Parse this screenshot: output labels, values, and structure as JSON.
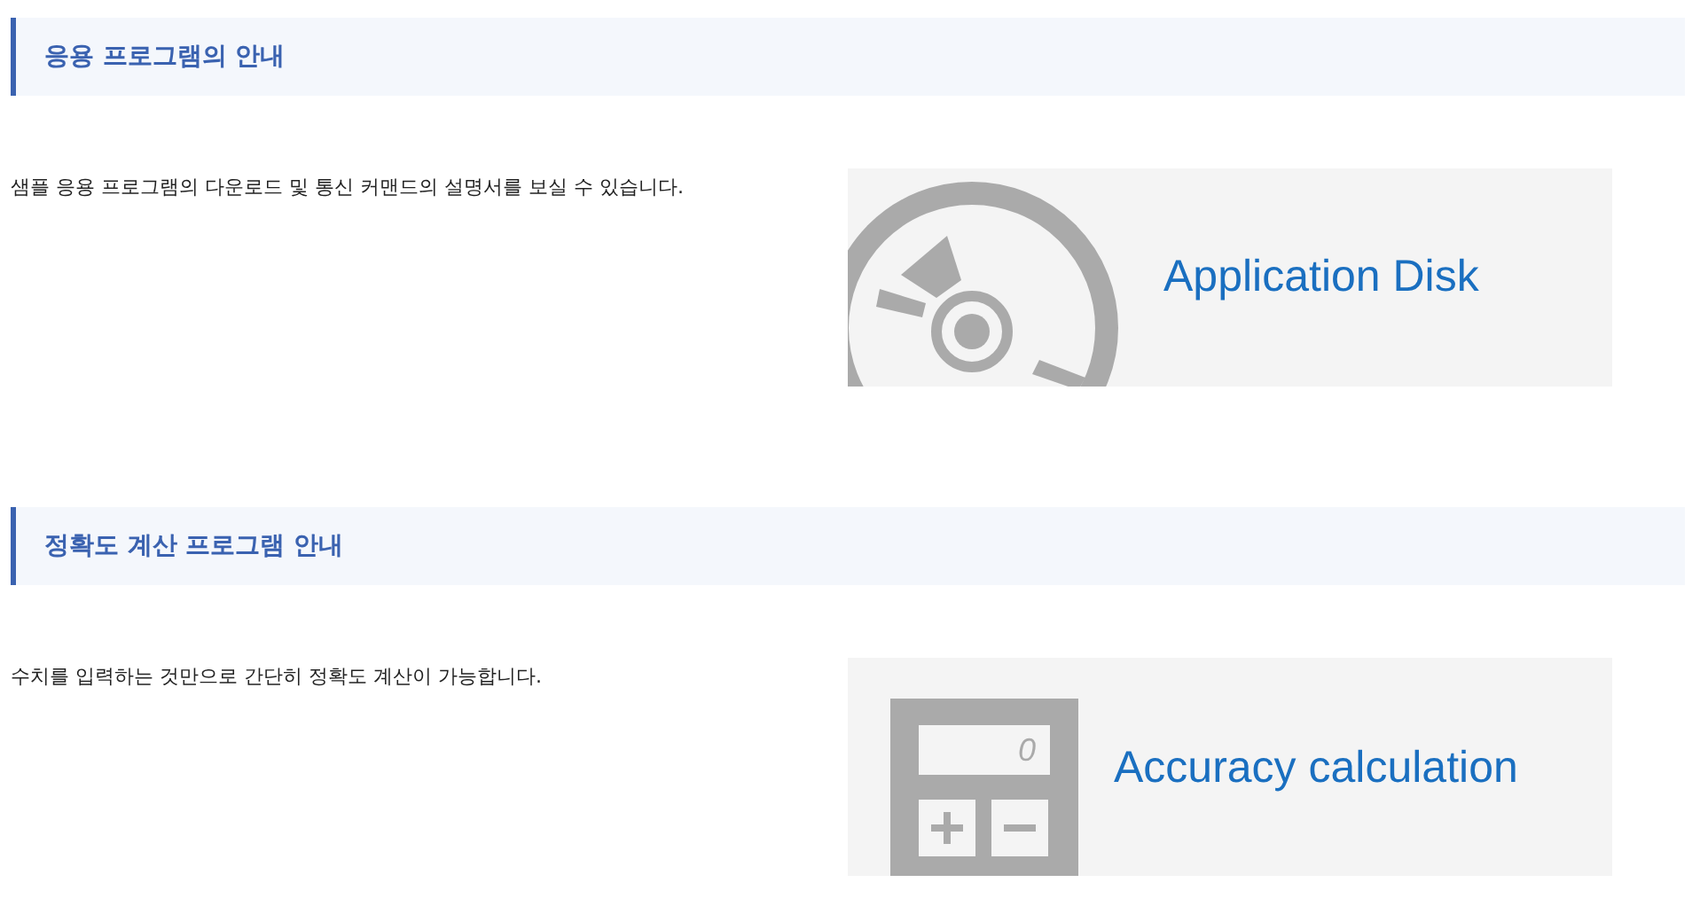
{
  "sections": [
    {
      "heading": "응용 프로그램의 안내",
      "description": "샘플 응용 프로그램의 다운로드 및 통신 커맨드의 설명서를 보실 수 있습니다.",
      "banner": {
        "kind": "disk",
        "label": "Application Disk"
      }
    },
    {
      "heading": "정확도 계산 프로그램 안내",
      "description": "수치를 입력하는 것만으로 간단히 정확도 계산이 가능합니다.",
      "banner": {
        "kind": "calculator",
        "label": "Accuracy calculation",
        "display": "0"
      }
    }
  ]
}
